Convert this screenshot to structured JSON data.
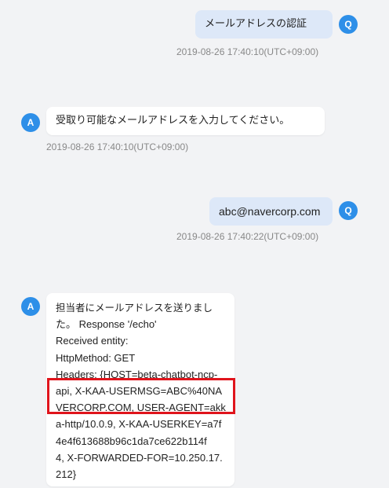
{
  "colors": {
    "avatar": "#2e8fe8",
    "user_bubble": "#dde8f8",
    "bot_bubble": "#ffffff",
    "highlight": "#e0141c"
  },
  "messages": [
    {
      "sender": "Q",
      "text": "メールアドレスの認証",
      "timestamp": "2019-08-26 17:40:10(UTC+09:00)"
    },
    {
      "sender": "A",
      "text": "受取り可能なメールアドレスを入力してください。",
      "timestamp": "2019-08-26 17:40:10(UTC+09:00)"
    },
    {
      "sender": "Q",
      "text": "abc@navercorp.com",
      "timestamp": "2019-08-26 17:40:22(UTC+09:00)"
    },
    {
      "sender": "A",
      "lines": [
        "担当者にメールアドレスを送りまし",
        "た。 Response '/echo'",
        "Received entity:",
        "HttpMethod: GET",
        "Headers: {HOST=beta-chatbot-ncp-",
        "api, X-KAA-USERMSG=ABC%40NA",
        "VERCORP.COM, USER-AGENT=akk",
        "a-http/10.0.9, X-KAA-USERKEY=a7f",
        "4e4f613688b96c1da7ce622b114f",
        "4, X-FORWARDED-FOR=10.250.17.",
        "212}"
      ]
    }
  ]
}
